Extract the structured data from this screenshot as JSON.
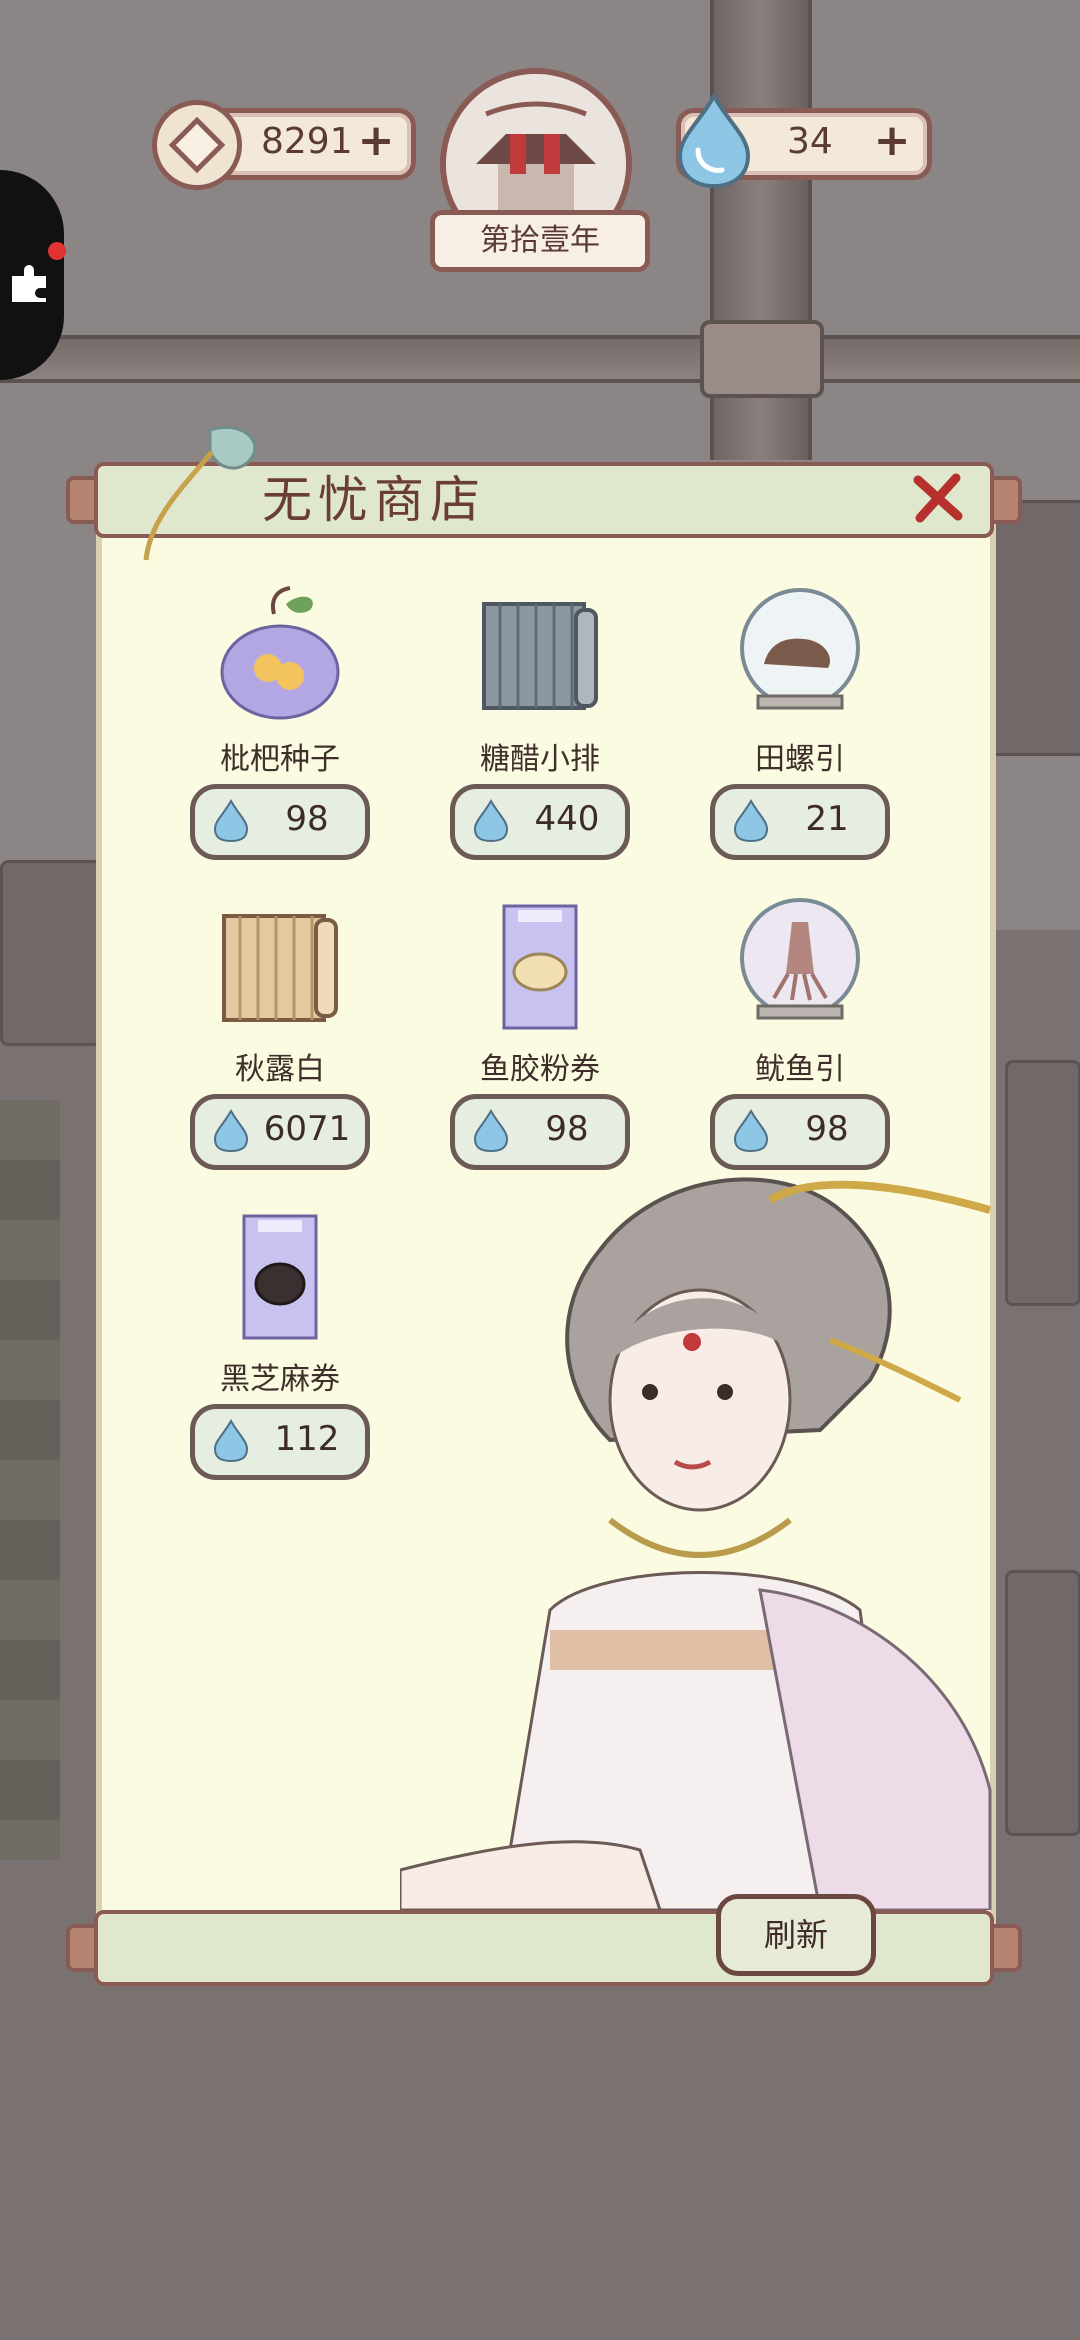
{
  "resources": {
    "coins": "8291",
    "water": "34"
  },
  "calendar": {
    "year_label": "第拾壹年"
  },
  "shop": {
    "title": "无忧商店",
    "refresh_label": "刷新",
    "items": [
      {
        "name": "枇杷种子",
        "price": "98",
        "icon": "loquat-seed-bag-icon"
      },
      {
        "name": "糖醋小排",
        "price": "440",
        "icon": "recipe-scroll-icon"
      },
      {
        "name": "田螺引",
        "price": "21",
        "icon": "snail-jar-icon"
      },
      {
        "name": "秋露白",
        "price": "6071",
        "icon": "wine-scroll-icon"
      },
      {
        "name": "鱼胶粉券",
        "price": "98",
        "icon": "fish-gelatin-ticket-icon"
      },
      {
        "name": "鱿鱼引",
        "price": "98",
        "icon": "squid-jar-icon"
      },
      {
        "name": "黑芝麻券",
        "price": "112",
        "icon": "black-sesame-ticket-icon"
      }
    ]
  },
  "colors": {
    "panel_bg": "#fbfbe2",
    "border": "#8a5b54",
    "accent_water": "#8ec6e6"
  }
}
